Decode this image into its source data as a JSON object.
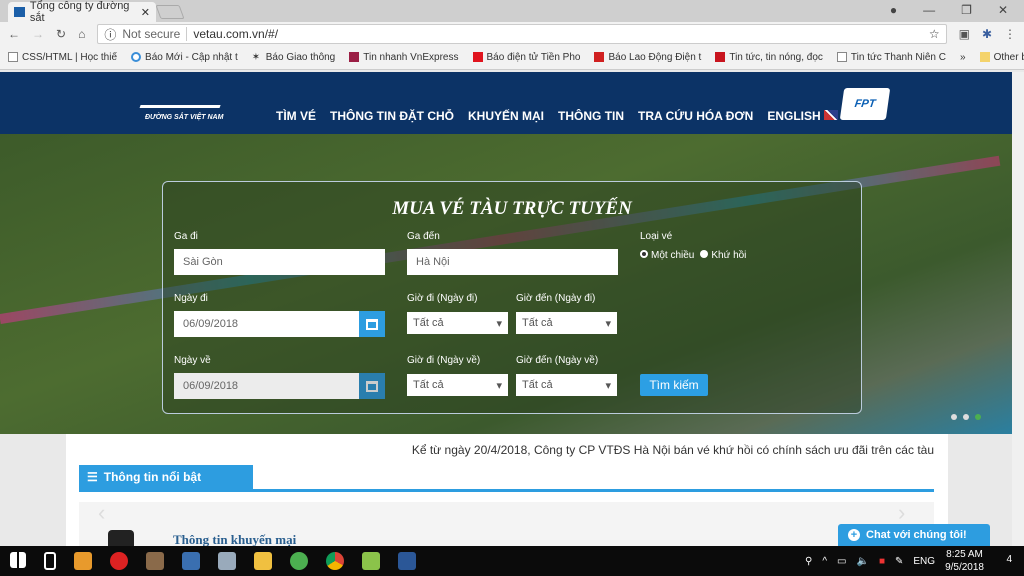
{
  "browser": {
    "tab_title": "Tổng công ty đường sắt",
    "url_security": "Not secure",
    "url": "vetau.com.vn/#/",
    "bookmarks": [
      "CSS/HTML | Học thiế",
      "Báo Mới - Cập nhật t",
      "Báo Giao thông",
      "Tin nhanh VnExpress",
      "Báo điện tử Tiền Pho",
      "Báo Lao Động Điện t",
      "Tin tức, tin nóng, đọc",
      "Tin tức Thanh Niên C"
    ],
    "more": "»",
    "other_bookmarks": "Other bookmarks"
  },
  "header": {
    "logo_text": "ĐƯỜNG SẮT VIỆT NAM",
    "logo_mark": "VNR",
    "nav": [
      "TÌM VÉ",
      "THÔNG TIN ĐẶT CHỖ",
      "KHUYẾN MẠI",
      "THÔNG TIN",
      "TRA CỨU HÓA ĐƠN",
      "ENGLISH"
    ],
    "partner_logo": "FPT"
  },
  "form": {
    "title": "MUA VÉ TÀU TRỰC TUYẾN",
    "from_label": "Ga đi",
    "from_value": "Sài Gòn",
    "to_label": "Ga đến",
    "to_value": "Hà Nội",
    "ticket_type_label": "Loại vé",
    "one_way": "Một chiều",
    "round_trip": "Khứ hồi",
    "selected_type": "Một chiều",
    "depart_date_label": "Ngày đi",
    "depart_date": "06/09/2018",
    "return_date_label": "Ngày về",
    "return_date": "06/09/2018",
    "dep_time_out_label": "Giờ đi (Ngày đi)",
    "arr_time_out_label": "Giờ đến (Ngày đi)",
    "dep_time_ret_label": "Giờ đi (Ngày về)",
    "arr_time_ret_label": "Giờ đến (Ngày về)",
    "all_option": "Tất cả",
    "search_button": "Tìm kiếm"
  },
  "content": {
    "news_ticker": "Kể từ ngày 20/4/2018, Công ty CP VTĐS Hà Nội bán vé khứ hồi có chính sách ưu đãi trên các tàu",
    "section_title": "Thông tin nổi bật",
    "item_title": "Thông tin khuyến mại"
  },
  "chat": {
    "label": "Chat với chúng tôi!"
  },
  "taskbar": {
    "lang": "ENG",
    "time": "8:25 AM",
    "date": "9/5/2018",
    "notifications": "4"
  }
}
